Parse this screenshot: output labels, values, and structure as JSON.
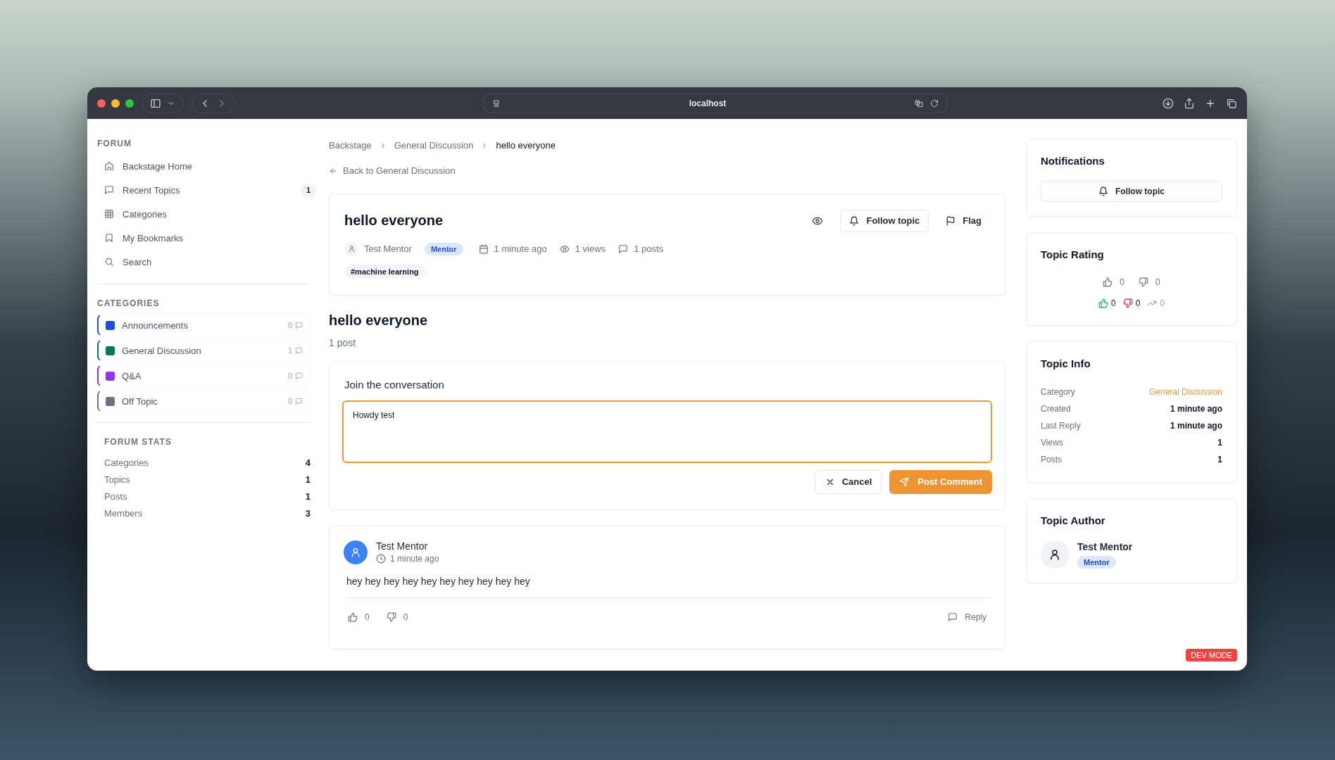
{
  "browser": {
    "url": "localhost"
  },
  "sidebar": {
    "forum_heading": "FORUM",
    "nav": [
      {
        "kind": "home",
        "label": "Backstage Home",
        "selected": false
      },
      {
        "kind": "chat",
        "label": "Recent Topics",
        "badge": "1",
        "selected": false
      },
      {
        "kind": "grid",
        "label": "Categories",
        "selected": false
      },
      {
        "kind": "bookmark",
        "label": "My Bookmarks",
        "selected": false
      },
      {
        "kind": "search",
        "label": "Search",
        "selected": false
      }
    ],
    "categories_heading": "CATEGORIES",
    "categories": [
      {
        "name": "Announcements",
        "color": "#1d4ed8",
        "count": "0"
      },
      {
        "name": "General Discussion",
        "color": "#047857",
        "count": "1"
      },
      {
        "name": "Q&A",
        "color": "#9333ea",
        "count": "0"
      },
      {
        "name": "Off Topic",
        "color": "#6b7280",
        "count": "0"
      }
    ],
    "stats_heading": "FORUM STATS",
    "stats": [
      {
        "label": "Categories",
        "value": "4"
      },
      {
        "label": "Topics",
        "value": "1"
      },
      {
        "label": "Posts",
        "value": "1"
      },
      {
        "label": "Members",
        "value": "3"
      }
    ]
  },
  "breadcrumb": [
    "Backstage",
    "General Discussion",
    "hello everyone"
  ],
  "back_link": "Back to General Discussion",
  "topic": {
    "title": "hello everyone",
    "author": "Test Mentor",
    "role": "Mentor",
    "created": "1 minute ago",
    "views": "1 views",
    "posts": "1 posts",
    "tags": [
      "#machine learning"
    ],
    "follow": "Follow topic",
    "flag": "Flag"
  },
  "thread": {
    "title": "hello everyone",
    "count": "1 post"
  },
  "composer": {
    "heading": "Join the conversation",
    "value": "Howdy test",
    "focused": true,
    "cancel": "Cancel",
    "submit": "Post Comment"
  },
  "posts": [
    {
      "author": "Test Mentor",
      "time": "1 minute ago",
      "body": "hey hey hey hey hey hey hey hey hey hey",
      "likes": "0",
      "dislikes": "0",
      "reply": "Reply"
    }
  ],
  "notifications": {
    "title": "Notifications",
    "button": "Follow topic"
  },
  "rating": {
    "title": "Topic Rating",
    "buttons": [
      {
        "kind": "up",
        "count": "0"
      },
      {
        "kind": "down",
        "count": "0"
      }
    ],
    "stats": [
      {
        "kind": "up",
        "count": "0"
      },
      {
        "kind": "down",
        "count": "0"
      },
      {
        "kind": "trend",
        "count": "0"
      }
    ]
  },
  "info": {
    "title": "Topic Info",
    "rows": [
      {
        "label": "Category",
        "value": "General Discussion",
        "kind": "link"
      },
      {
        "label": "Created",
        "value": "1 minute ago",
        "kind": "text"
      },
      {
        "label": "Last Reply",
        "value": "1 minute ago",
        "kind": "text"
      },
      {
        "label": "Views",
        "value": "1",
        "kind": "text"
      },
      {
        "label": "Posts",
        "value": "1",
        "kind": "text"
      }
    ]
  },
  "author_card": {
    "title": "Topic Author",
    "name": "Test Mentor",
    "role": "Mentor"
  },
  "dev_badge": "DEV MODE"
}
